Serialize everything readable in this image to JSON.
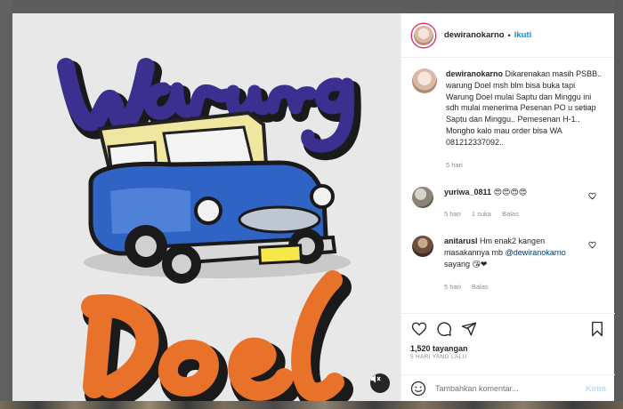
{
  "header": {
    "username": "dewiranokarno",
    "dot": "•",
    "follow_label": "Ikuti"
  },
  "media": {
    "icon": "mute-icon"
  },
  "caption": {
    "username": "dewiranokarno",
    "text": "Dikarenakan masih PSBB.. warung Doel msh blm bisa buka tapi Warung Doel mulai Saptu dan Minggu ini sdh mulai menerima Pesenan PO u setiap Saptu dan Minggu.. Pemesenan H-1.. Mongho kalo mau order bisa WA 081212337092..",
    "time": "5 hari"
  },
  "comments": [
    {
      "username": "yuriwa_0811",
      "text": "😍😍😍😍",
      "time": "5 hari",
      "likes": "1 suka",
      "reply": "Balas"
    },
    {
      "username": "anitarusl",
      "text": "Hm enak2 kangen masakannya mb",
      "mention": "@dewiranokarno",
      "text_after": "sayang 😘❤",
      "time": "5 hari",
      "reply": "Balas"
    }
  ],
  "actions": {
    "views": "1,520 tayangan",
    "time_ago": "5 HARI YANG LALU"
  },
  "add_comment": {
    "placeholder": "Tambahkan komentar...",
    "post_label": "Kirim"
  },
  "colors": {
    "link_blue": "#0095f6",
    "post_disabled": "#b2dffc",
    "logo_purple": "#3b2f8f",
    "logo_orange": "#e8722a",
    "car_blue": "#2f63c4"
  }
}
